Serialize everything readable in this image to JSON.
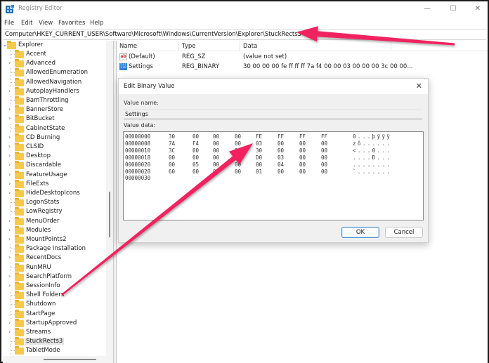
{
  "window": {
    "title": "Registry Editor",
    "controls": {
      "minimize": "—",
      "maximize": "☐",
      "close": "✕"
    }
  },
  "menu": [
    "File",
    "Edit",
    "View",
    "Favorites",
    "Help"
  ],
  "address": "Computer\\HKEY_CURRENT_USER\\Software\\Microsoft\\Windows\\CurrentVersion\\Explorer\\StuckRects3",
  "tree": {
    "root": "Explorer",
    "items": [
      {
        "label": "Accent",
        "expandable": false
      },
      {
        "label": "Advanced",
        "expandable": true
      },
      {
        "label": "AllowedEnumeration",
        "expandable": false
      },
      {
        "label": "AllowedNavigation",
        "expandable": false
      },
      {
        "label": "AutoplayHandlers",
        "expandable": true
      },
      {
        "label": "BamThrottling",
        "expandable": false
      },
      {
        "label": "BannerStore",
        "expandable": true
      },
      {
        "label": "BitBucket",
        "expandable": true
      },
      {
        "label": "CabinetState",
        "expandable": false
      },
      {
        "label": "CD Burning",
        "expandable": true
      },
      {
        "label": "CLSID",
        "expandable": true
      },
      {
        "label": "Desktop",
        "expandable": true
      },
      {
        "label": "Discardable",
        "expandable": true
      },
      {
        "label": "FeatureUsage",
        "expandable": true
      },
      {
        "label": "FileExts",
        "expandable": true
      },
      {
        "label": "HideDesktopIcons",
        "expandable": true
      },
      {
        "label": "LogonStats",
        "expandable": false
      },
      {
        "label": "LowRegistry",
        "expandable": false
      },
      {
        "label": "MenuOrder",
        "expandable": true
      },
      {
        "label": "Modules",
        "expandable": true
      },
      {
        "label": "MountPoints2",
        "expandable": true
      },
      {
        "label": "Package Installation",
        "expandable": false
      },
      {
        "label": "RecentDocs",
        "expandable": true
      },
      {
        "label": "RunMRU",
        "expandable": false
      },
      {
        "label": "SearchPlatform",
        "expandable": true
      },
      {
        "label": "SessionInfo",
        "expandable": true
      },
      {
        "label": "Shell Folders",
        "expandable": false
      },
      {
        "label": "Shutdown",
        "expandable": false
      },
      {
        "label": "StartPage",
        "expandable": false
      },
      {
        "label": "StartupApproved",
        "expandable": true
      },
      {
        "label": "Streams",
        "expandable": true
      },
      {
        "label": "StuckRects3",
        "expandable": false,
        "selected": true
      },
      {
        "label": "TabletMode",
        "expandable": false
      }
    ]
  },
  "list": {
    "columns": [
      "Name",
      "Type",
      "Data"
    ],
    "rows": [
      {
        "icon": "string-value-icon",
        "name": "(Default)",
        "type": "REG_SZ",
        "data": "(value not set)"
      },
      {
        "icon": "binary-value-icon",
        "name": "Settings",
        "type": "REG_BINARY",
        "data": "30 00 00 00 fe ff ff ff 7a f4 00 00 03 00 00 00 3c 00 00..."
      }
    ]
  },
  "dialog": {
    "title": "Edit Binary Value",
    "value_name_label": "Value name:",
    "value_name": "Settings",
    "value_data_label": "Value data:",
    "hex_rows": [
      {
        "offset": "00000000",
        "bytes": [
          "30",
          "00",
          "00",
          "00",
          "FE",
          "FF",
          "FF",
          "FF"
        ],
        "ascii": "0...þÿÿÿ"
      },
      {
        "offset": "00000008",
        "bytes": [
          "7A",
          "F4",
          "00",
          "00",
          "03",
          "00",
          "00",
          "00"
        ],
        "ascii": "zô......"
      },
      {
        "offset": "00000010",
        "bytes": [
          "3C",
          "00",
          "00",
          "00",
          "30",
          "00",
          "00",
          "00"
        ],
        "ascii": "<...0..."
      },
      {
        "offset": "00000018",
        "bytes": [
          "00",
          "00",
          "00",
          "00",
          "D0",
          "03",
          "00",
          "00"
        ],
        "ascii": "....Ð..."
      },
      {
        "offset": "00000020",
        "bytes": [
          "00",
          "05",
          "00",
          "00",
          "00",
          "04",
          "00",
          "00"
        ],
        "ascii": "........"
      },
      {
        "offset": "00000028",
        "bytes": [
          "60",
          "00",
          "00",
          "00",
          "01",
          "00",
          "00",
          "00"
        ],
        "ascii": "`......."
      },
      {
        "offset": "00000030",
        "bytes": [],
        "ascii": ""
      }
    ],
    "ok_label": "OK",
    "cancel_label": "Cancel"
  },
  "annotations": {
    "arrow_color": "#f0245f"
  }
}
